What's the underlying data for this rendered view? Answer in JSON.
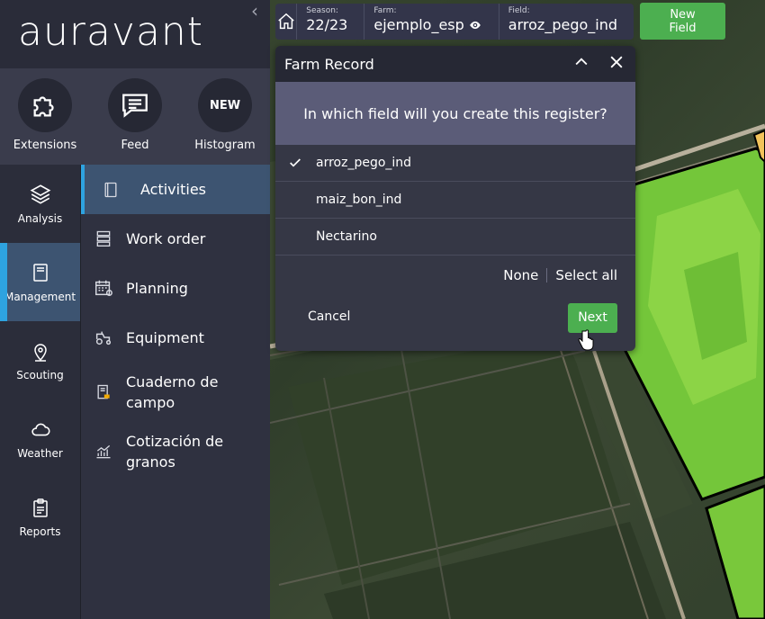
{
  "app": {
    "logo": "auravant"
  },
  "quick_actions": [
    {
      "label": "Extensions",
      "icon": "puzzle-icon"
    },
    {
      "label": "Feed",
      "icon": "chat-icon"
    },
    {
      "label": "Histogram",
      "badge": "NEW"
    }
  ],
  "rail": [
    {
      "label": "Analysis",
      "icon": "layers-icon"
    },
    {
      "label": "Management",
      "icon": "notebook-icon",
      "active": true
    },
    {
      "label": "Scouting",
      "icon": "pin-icon"
    },
    {
      "label": "Weather",
      "icon": "cloud-icon"
    },
    {
      "label": "Reports",
      "icon": "clipboard-icon"
    }
  ],
  "submenu": [
    {
      "label": "Activities",
      "icon": "book-icon",
      "active": true
    },
    {
      "label": "Work order",
      "icon": "server-icon"
    },
    {
      "label": "Planning",
      "icon": "calendar-icon"
    },
    {
      "label": "Equipment",
      "icon": "tractor-icon"
    },
    {
      "label": "Cuaderno de campo",
      "lines": [
        "Cuaderno de",
        "campo"
      ],
      "icon": "field-book-icon"
    },
    {
      "label": "Cotización de granos",
      "lines": [
        "Cotización de",
        "granos"
      ],
      "icon": "chart-icon"
    }
  ],
  "breadcrumb": {
    "season_label": "Season:",
    "season": "22/23",
    "farm_label": "Farm:",
    "farm": "ejemplo_esp",
    "field_label": "Field:",
    "field": "arroz_pego_ind"
  },
  "new_field": {
    "line1": "New",
    "line2": "Field"
  },
  "dialog": {
    "title": "Farm Record",
    "question": "In which field will you create this register?",
    "options": [
      {
        "label": "arroz_pego_ind",
        "checked": true
      },
      {
        "label": "maiz_bon_ind",
        "checked": false
      },
      {
        "label": "Nectarino",
        "checked": false
      }
    ],
    "none_label": "None",
    "select_all_label": "Select all",
    "cancel_label": "Cancel",
    "next_label": "Next"
  },
  "colors": {
    "accent": "#2ea3e0",
    "green": "#4caf50",
    "active_bg": "#3d5471"
  }
}
